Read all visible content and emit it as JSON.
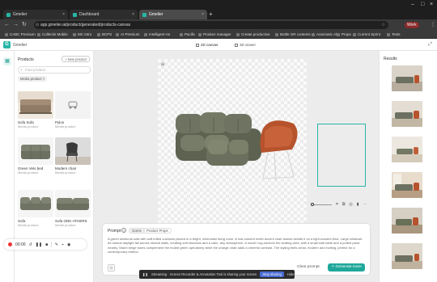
{
  "browser": {
    "tabs": [
      {
        "title": "Gmelier",
        "active": false
      },
      {
        "title": "Dashboard",
        "active": false
      },
      {
        "title": "Gmelier",
        "active": true
      }
    ],
    "url": "app.gmelier.ai/product/generated/products-canvas",
    "profile": "Work",
    "bookmarks": [
      "CABC Premium",
      "Collectin Mobile",
      "MC Intro",
      "BCPS",
      "AI Premium",
      "Intelligent Ho",
      "Pacific",
      "Product manager",
      "Create productive",
      "Bottle OR contents",
      "Automatic Al",
      "Props",
      "Current Sprint",
      "Tests"
    ]
  },
  "app": {
    "name": "Gmelier",
    "view_tabs": [
      "2D canvas",
      "3D viewer"
    ]
  },
  "products": {
    "title": "Products",
    "new_button": "New product",
    "search_placeholder": "Find product",
    "filter_chip": "Media product ×",
    "items": [
      {
        "name": "Sofa Sofa",
        "sub": "Media product"
      },
      {
        "name": "Pylon",
        "sub": "Media product"
      },
      {
        "name": "Green Velo bed",
        "sub": "Media product"
      },
      {
        "name": "Modern chair",
        "sub": "Media product"
      },
      {
        "name": "Sofa",
        "sub": "Media product"
      },
      {
        "name": "Sofa ODK-ATHERS",
        "sub": "Media product"
      }
    ]
  },
  "canvas": {
    "frame_corner": "⊞"
  },
  "prompt": {
    "label": "Prompt",
    "help": "?",
    "tabs": [
      "Scene",
      "Product Props"
    ],
    "text": "A green sectional sofa with soft tufted cushions placed in a bright, minimalist living room. A rust-colored mesh accent chair stands beside it on a light wooden floor. Large windows let natural daylight fall across neutral walls, creating soft shadows and a calm, airy atmosphere. A woven rug anchors the seating area, with a small side table and a potted plant nearby. Warm beige tones complement the muted green upholstery while the orange chair adds a cheerful contrast. The styling feels clean, modern and inviting, perfect for a contemporary interior.",
    "clear": "Clear prompt",
    "generate": "Generate more"
  },
  "results": {
    "title": "Results"
  },
  "recorder": {
    "time": "00:00"
  },
  "share_bar": {
    "text": "Streaming · Screen Recorder & Annotation Tool is sharing your screen",
    "stop": "Stop sharing",
    "hide": "Hide"
  }
}
